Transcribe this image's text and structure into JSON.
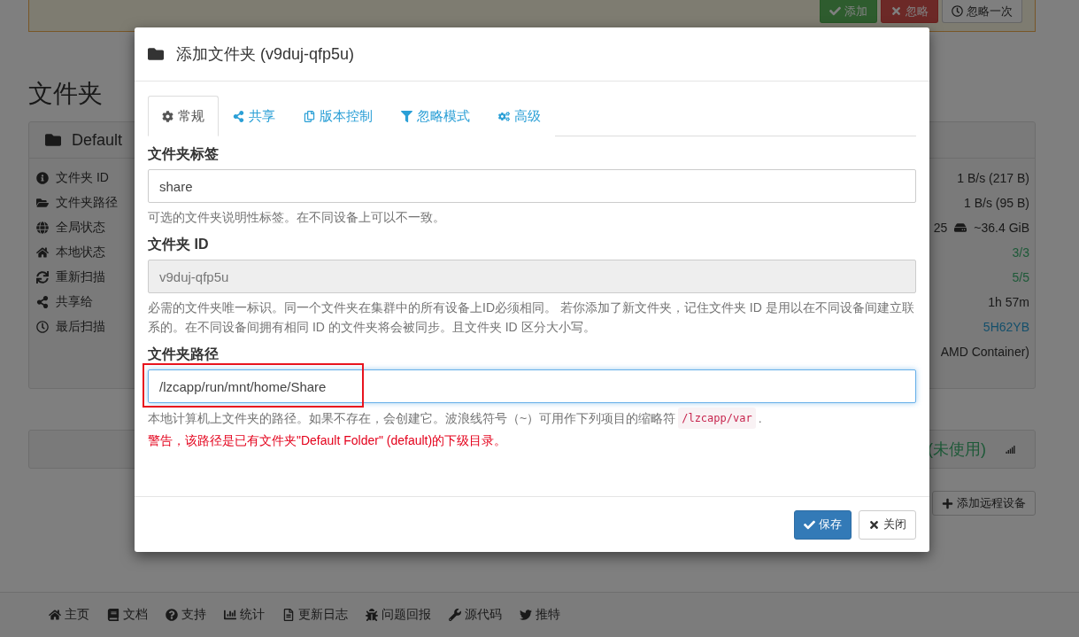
{
  "notice": {
    "buttons": [
      {
        "label": "添加",
        "kind": "success"
      },
      {
        "label": "忽略",
        "kind": "danger"
      },
      {
        "label": "忽略一次",
        "kind": "default"
      }
    ]
  },
  "page_title": "文件夹",
  "folder_panel": {
    "title": "Default",
    "labels": [
      "文件夹 ID",
      "文件夹路径",
      "全局状态",
      "本地状态",
      "重新扫描",
      "共享给",
      "最后扫描"
    ],
    "values": [
      {
        "kind": "plain",
        "text": "1 B/s (217 B)"
      },
      {
        "kind": "plain",
        "text": "1 B/s (95 B)"
      },
      {
        "kind": "storage",
        "prefix": "25",
        "text": "~36.4 GiB"
      },
      {
        "kind": "success",
        "text": "3/3"
      },
      {
        "kind": "success",
        "text": "5/5"
      },
      {
        "kind": "plain",
        "text": "1h 57m"
      },
      {
        "kind": "link",
        "text": "5H62YB"
      },
      {
        "kind": "plain",
        "text": "AMD Container)"
      }
    ]
  },
  "device_panel": {
    "status": "(未使用)"
  },
  "add_device_button": "添加远程设备",
  "footer_links": [
    "主页",
    "文档",
    "支持",
    "统计",
    "更新日志",
    "问题回报",
    "源代码",
    "推特"
  ],
  "dialog": {
    "title": "添加文件夹 (v9duj-qfp5u)",
    "tabs": [
      {
        "label": "常规",
        "selected": true
      },
      {
        "label": "共享",
        "selected": false
      },
      {
        "label": "版本控制",
        "selected": false
      },
      {
        "label": "忽略模式",
        "selected": false
      },
      {
        "label": "高级",
        "selected": false
      }
    ],
    "fields": [
      {
        "label": "文件夹标签",
        "value": "share",
        "readonly": false,
        "focused": false,
        "highlighted": false,
        "help": "可选的文件夹说明性标签。在不同设备上可以不一致。"
      },
      {
        "label": "文件夹 ID",
        "value": "v9duj-qfp5u",
        "readonly": true,
        "focused": false,
        "highlighted": false,
        "help": "必需的文件夹唯一标识。同一个文件夹在集群中的所有设备上ID必须相同。 若你添加了新文件夹，记住文件夹 ID 是用以在不同设备间建立联系的。在不同设备间拥有相同 ID 的文件夹将会被同步。且文件夹 ID 区分大小写。"
      },
      {
        "label": "文件夹路径",
        "value": "/lzcapp/run/mnt/home/Share",
        "readonly": false,
        "focused": true,
        "highlighted": true,
        "help": "本地计算机上文件夹的路径。如果不存在，会创建它。波浪线符号（~）可用作下列项目的缩略符",
        "help_code": "/lzcapp/var",
        "help_suffix": ".",
        "warning": "警告，该路径是已有文件夹\"Default Folder\" (default)的下级目录。"
      }
    ],
    "buttons": [
      {
        "label": "保存",
        "kind": "primary"
      },
      {
        "label": "关闭",
        "kind": "default"
      }
    ]
  }
}
